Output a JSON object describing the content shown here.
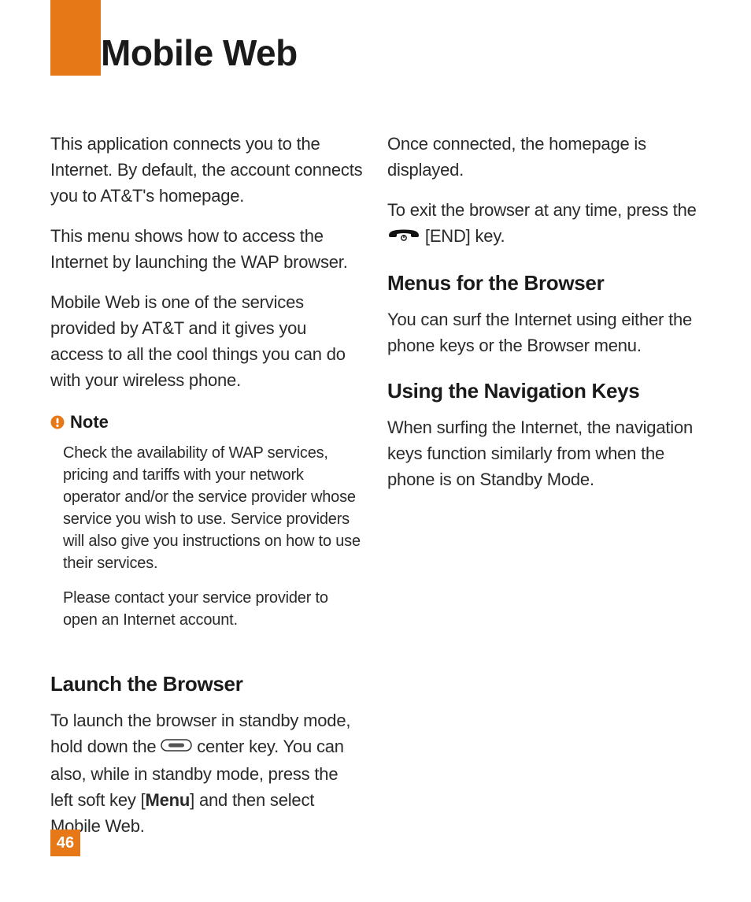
{
  "title": "Mobile Web",
  "page_number": "46",
  "col1": {
    "p1": "This application connects you to the Internet. By default, the account connects you to AT&T's homepage.",
    "p2": "This menu shows how to access the Internet by launching the WAP browser.",
    "p3": "Mobile Web is one of the services provided by AT&T and it gives you access to all the cool things you can do with your wireless phone.",
    "note_label": "Note",
    "note_p1": "Check the availability of WAP services, pricing and tariffs with your network operator and/or the service provider whose service you wish to use. Service providers will also give you instructions on how to use their services.",
    "note_p2": "Please contact your service provider to open an Internet account.",
    "h_launch": "Launch the Browser",
    "launch_pre": "To launch the browser in standby mode, hold down the ",
    "launch_mid": " center key. You can also, while in standby mode, press the left soft key [",
    "launch_menu": "Menu",
    "launch_post": "] and then select Mobile Web."
  },
  "col2": {
    "p1": "Once connected, the homepage is displayed.",
    "exit_pre": "To exit the browser at any time, press the ",
    "exit_post": " [END] key.",
    "h_menus": "Menus for the Browser",
    "p_menus": "You can surf the Internet using either the phone keys or the Browser menu.",
    "h_nav": "Using the Navigation Keys",
    "p_nav": "When surfing the Internet, the navigation keys function similarly from when the phone is on Standby Mode."
  }
}
